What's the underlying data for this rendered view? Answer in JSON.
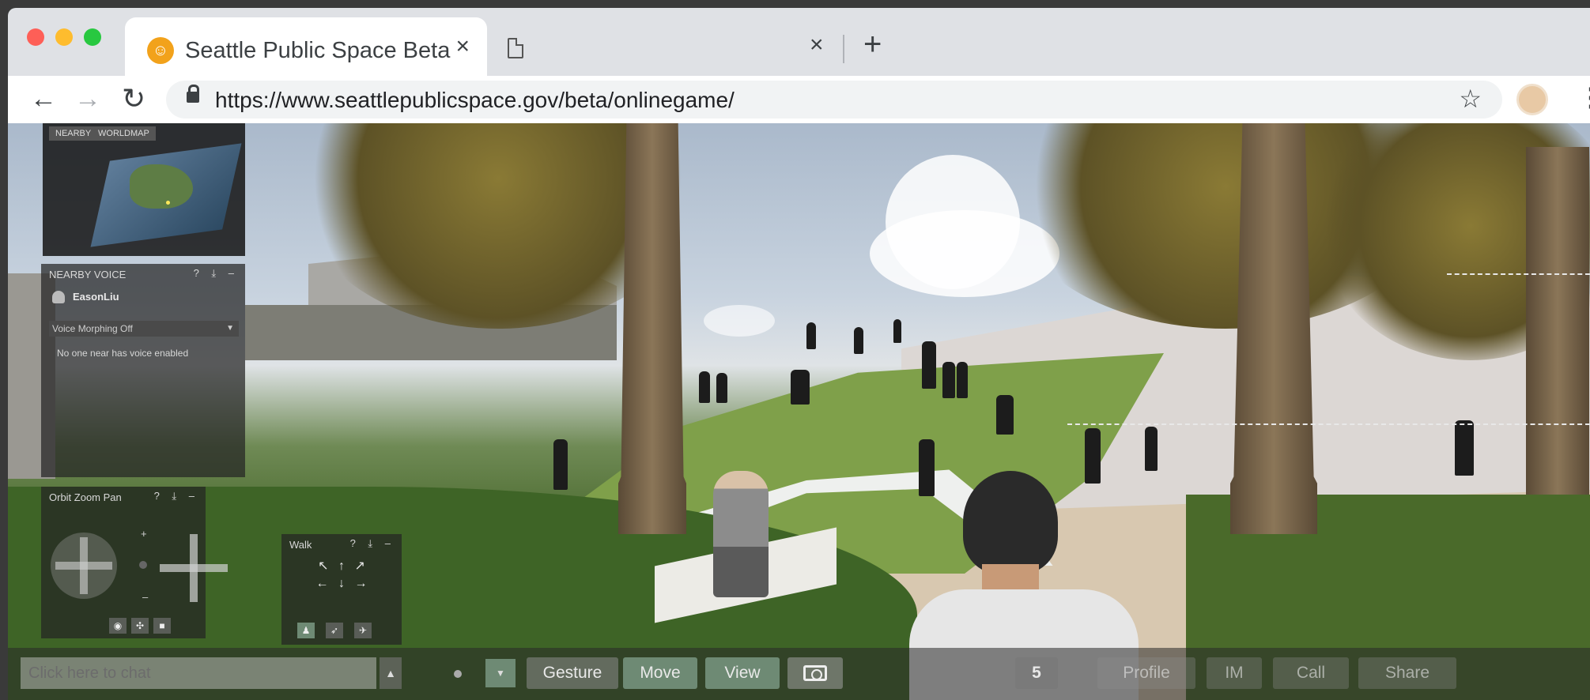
{
  "browser": {
    "tab_active_title": "Seattle Public Space Beta",
    "tab_close": "×",
    "tab2_close": "×",
    "new_tab": "+",
    "url": "https://www.seattlepublicspace.gov/beta/onlinegame/",
    "back": "←",
    "forward": "→",
    "reload": "↻",
    "bookmark": "☆",
    "menu": "⋮"
  },
  "minimap": {
    "tabs": [
      "NEARBY",
      "WORLDMAP"
    ]
  },
  "voice_panel": {
    "title": "NEARBY VOICE",
    "controls": "? ⤓ –",
    "user": "EasonLiu",
    "morph_option": "Voice Morphing Off",
    "message": "No one near has voice enabled"
  },
  "orbit_panel": {
    "title": "Orbit Zoom Pan",
    "controls": "? ⤓ –",
    "zoom_plus": "+",
    "zoom_minus": "–"
  },
  "walk_panel": {
    "title": "Walk",
    "controls": "? ⤓ –",
    "arrows": "↖ ↑ ↗\n← ↓ →"
  },
  "bottom_bar": {
    "chat_placeholder": "Click here to chat",
    "gesture": "Gesture",
    "move": "Move",
    "view": "View",
    "count": "5",
    "profile": "Profile",
    "im": "IM",
    "call": "Call",
    "share": "Share"
  },
  "colors": {
    "accent_green": "#6e8a74",
    "browser_chrome": "#dfe1e5"
  }
}
